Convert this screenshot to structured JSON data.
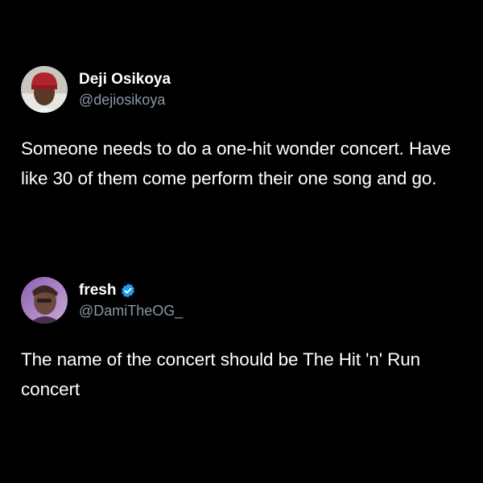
{
  "colors": {
    "background": "#000000",
    "text": "#ffffff",
    "handle": "#8b98a5",
    "verified_badge": "#1d9bf0"
  },
  "tweets": [
    {
      "author": {
        "display_name": "Deji Osikoya",
        "handle": "@dejiosikoya",
        "avatar": "avatar-photo-red-cap",
        "verified": false
      },
      "text": "Someone needs to do a one-hit wonder concert. Have like 30 of them come perform their one song and go."
    },
    {
      "author": {
        "display_name": "fresh",
        "handle": "@DamiTheOG_",
        "avatar": "avatar-photo-purple",
        "verified": true,
        "badge_icon": "verified-badge-icon"
      },
      "text": "The name of the concert should be The Hit 'n' Run concert"
    }
  ]
}
